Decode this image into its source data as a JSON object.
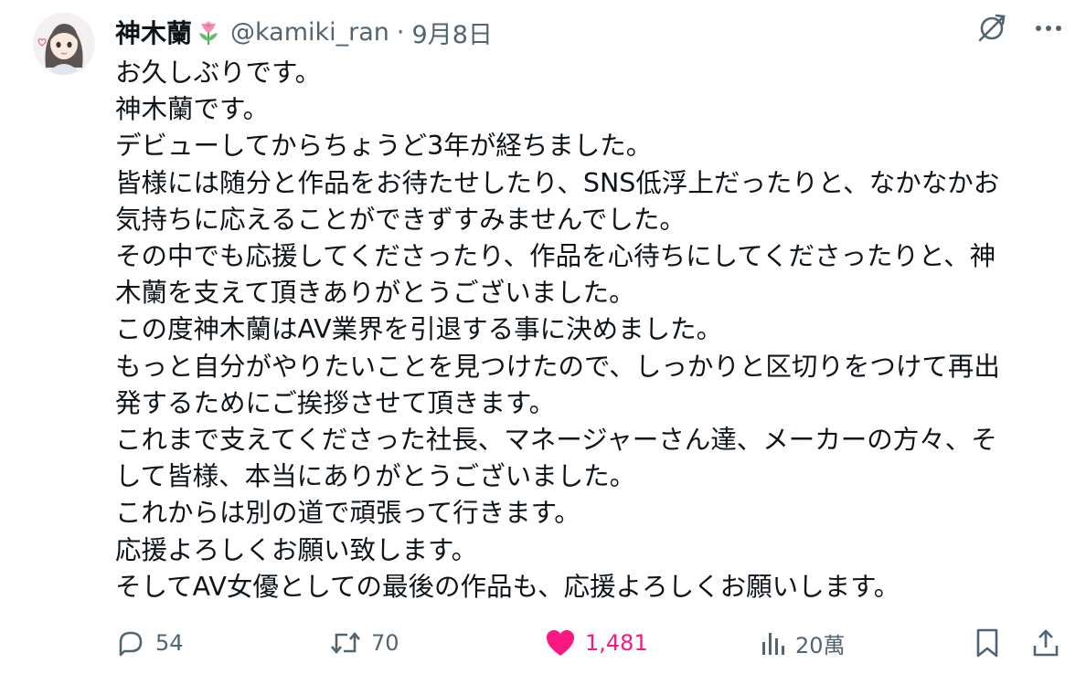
{
  "tweet": {
    "author_name": "神木蘭",
    "handle": "@kamiki_ran",
    "separator": "·",
    "date": "9月8日",
    "avatar_icon": "avatar-girl",
    "name_emoji_icon": "tulip-icon",
    "body_lines": [
      "お久しぶりです。",
      "神木蘭です。",
      "デビューしてからちょうど3年が経ちました。",
      "皆様には随分と作品をお待たせしたり、SNS低浮上だったりと、なかなかお",
      "気持ちに応えることができずすみませんでした。",
      "その中でも応援してくださったり、作品を心待ちにしてくださったりと、神",
      "木蘭を支えて頂きありがとうございました。",
      "この度神木蘭はAV業界を引退する事に決めました。",
      "もっと自分がやりたいことを見つけたので、しっかりと区切りをつけて再出",
      "発するためにご挨拶させて頂きます。",
      "これまで支えてくださった社長、マネージャーさん達、メーカーの方々、そ",
      "して皆様、本当にありがとうございました。",
      "これからは別の道で頑張って行きます。",
      "応援よろしくお願い致します。",
      "そしてAV女優としての最後の作品も、応援よろしくお願いします。"
    ],
    "stats": {
      "replies": "54",
      "reposts": "70",
      "likes": "1,481",
      "views": "20萬"
    },
    "colors": {
      "text": "#0f1419",
      "secondary": "#536471",
      "like": "#f91880"
    }
  }
}
